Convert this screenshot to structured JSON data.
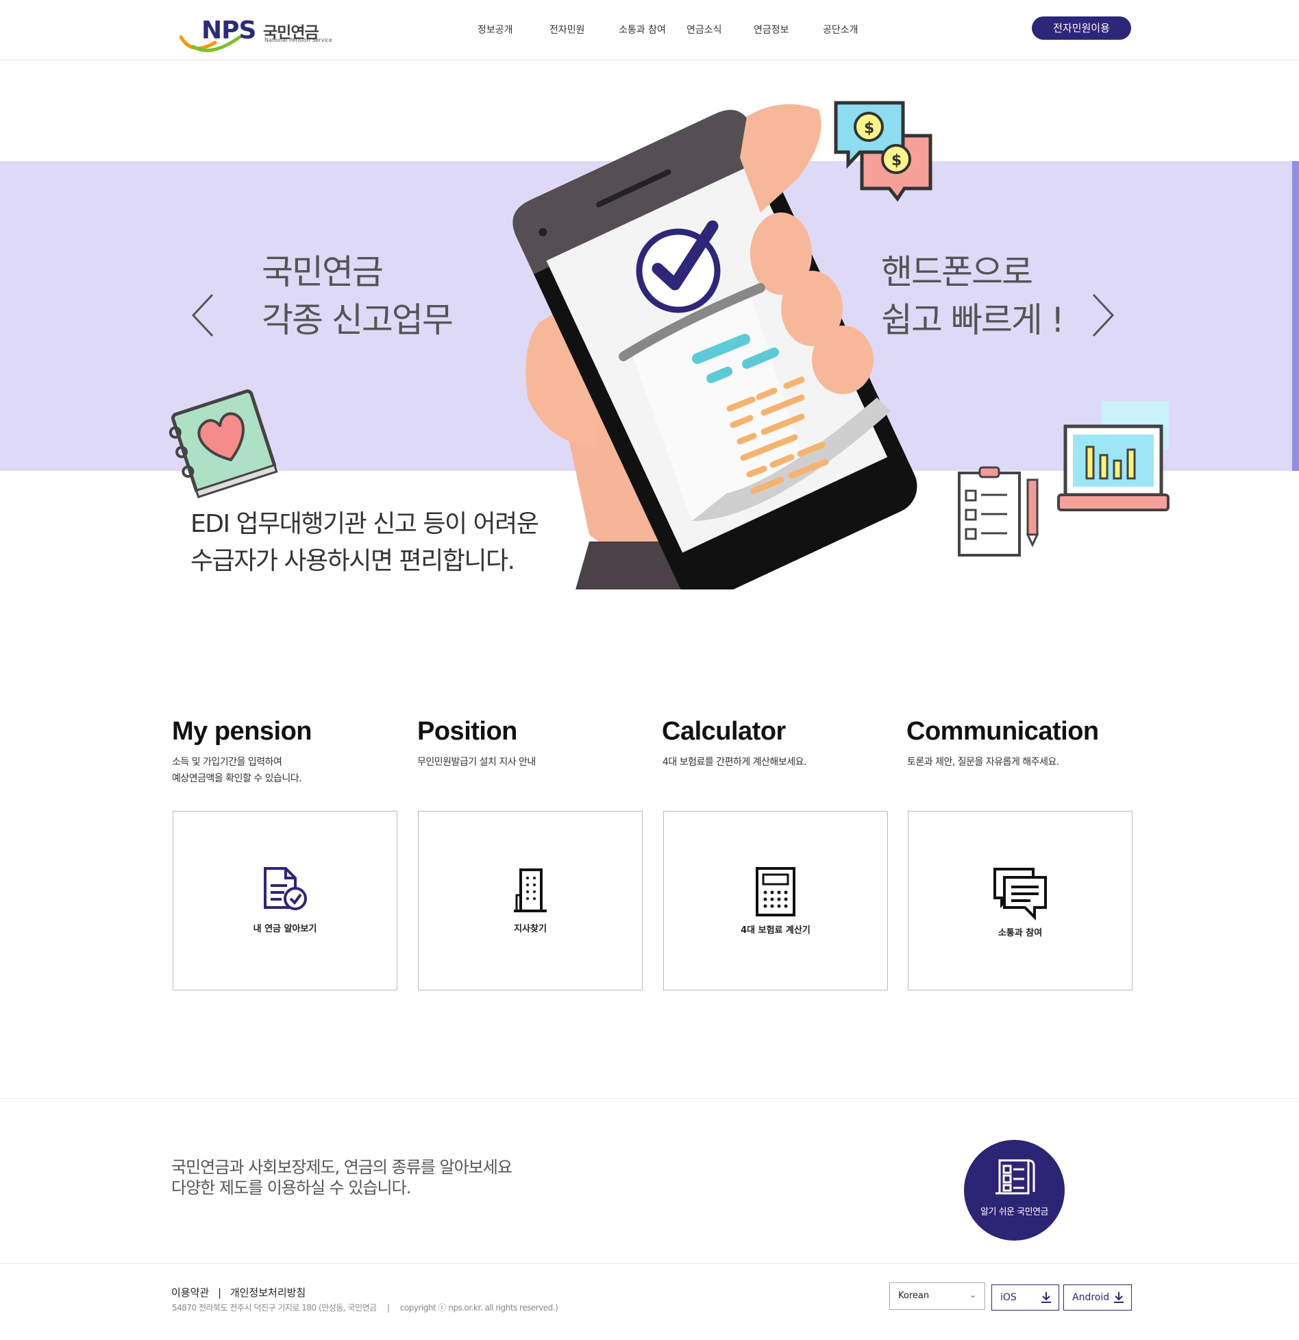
{
  "header": {
    "logo": {
      "brand": "NPS",
      "name_kr": "국민연금",
      "name_en": "National Pension Service"
    },
    "nav": [
      "정보공개",
      "전자민원",
      "소통과 참여",
      "연금소식",
      "연금정보",
      "공단소개"
    ],
    "cta_label": "전자민원이용",
    "accent": "#2e2678"
  },
  "hero": {
    "left_line1": "국민연금",
    "left_line2": "각종 신고업무",
    "right_line1": "핸드폰으로",
    "right_line2": "쉽고 빠르게 !",
    "sub_line1": "EDI 업무대행기관 신고 등이 어려운",
    "sub_line2": "수급자가 사용하시면 편리합니다.",
    "background": "#dfd9f8",
    "prev_icon": "chevron-left-icon",
    "next_icon": "chevron-right-icon"
  },
  "services": [
    {
      "title": "My pension",
      "desc1": "소득 및 가입기간을 입력하여",
      "desc2": "예상연금액을 확인할 수 있습니다.",
      "card_label": "내 연금 알아보기",
      "icon": "document-check-icon"
    },
    {
      "title": "Position",
      "desc1": "무인민원발급기 설치 지사 안내",
      "desc2": "",
      "card_label": "지사찾기",
      "icon": "building-icon"
    },
    {
      "title": "Calculator",
      "desc1": "4대 보험료를 간편하게 계산해보세요.",
      "desc2": "",
      "card_label": "4대 보험료 계산기",
      "icon": "calculator-icon"
    },
    {
      "title": "Communication",
      "desc1": "토론과 제안, 질문을 자유롭게 해주세요.",
      "desc2": "",
      "card_label": "소통과 참여",
      "icon": "chat-bubbles-icon"
    }
  ],
  "info": {
    "line1": "국민연금과 사회보장제도, 연금의 종류를 알아보세요",
    "line2": "다양한 제도를 이용하실 수 있습니다.",
    "circle_label": "알기 쉬운 국민연금",
    "circle_icon": "checklist-scroll-icon"
  },
  "footer": {
    "terms": "이용약관",
    "separator": "|",
    "privacy": "개인정보처리방침",
    "address": "54870 전라북도 전주시 덕진구 기지로 180 (만성동, 국민연금",
    "copyright": "copyright ⓒ nps.or.kr. all rights reserved.)",
    "language": "Korean",
    "ios_label": "iOS",
    "android_label": "Android",
    "download_icon": "download-icon"
  }
}
